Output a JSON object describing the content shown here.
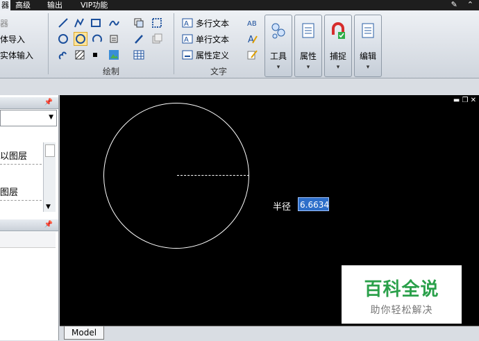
{
  "tabs": [
    "器",
    "高级",
    "输出",
    "VIP功能"
  ],
  "left_items": [
    "器",
    "体导入",
    "实体输入"
  ],
  "draw_group_label": "绘制",
  "text_group": {
    "label": "文字",
    "items": [
      "多行文本",
      "单行文本",
      "属性定义"
    ]
  },
  "big_buttons": [
    "工具",
    "属性",
    "捕捉",
    "编辑"
  ],
  "panel": {
    "layers": [
      "以图层",
      "图层"
    ]
  },
  "canvas": {
    "radius_label": "半径",
    "radius_value": "6.6634"
  },
  "watermark": {
    "title": "百科全说",
    "subtitle": "助你轻松解决"
  },
  "model_tab": "Model",
  "colors": {
    "canvas_bg": "#000000",
    "accent_input": "#2d6ec9",
    "watermark_green": "#2aa04a"
  }
}
